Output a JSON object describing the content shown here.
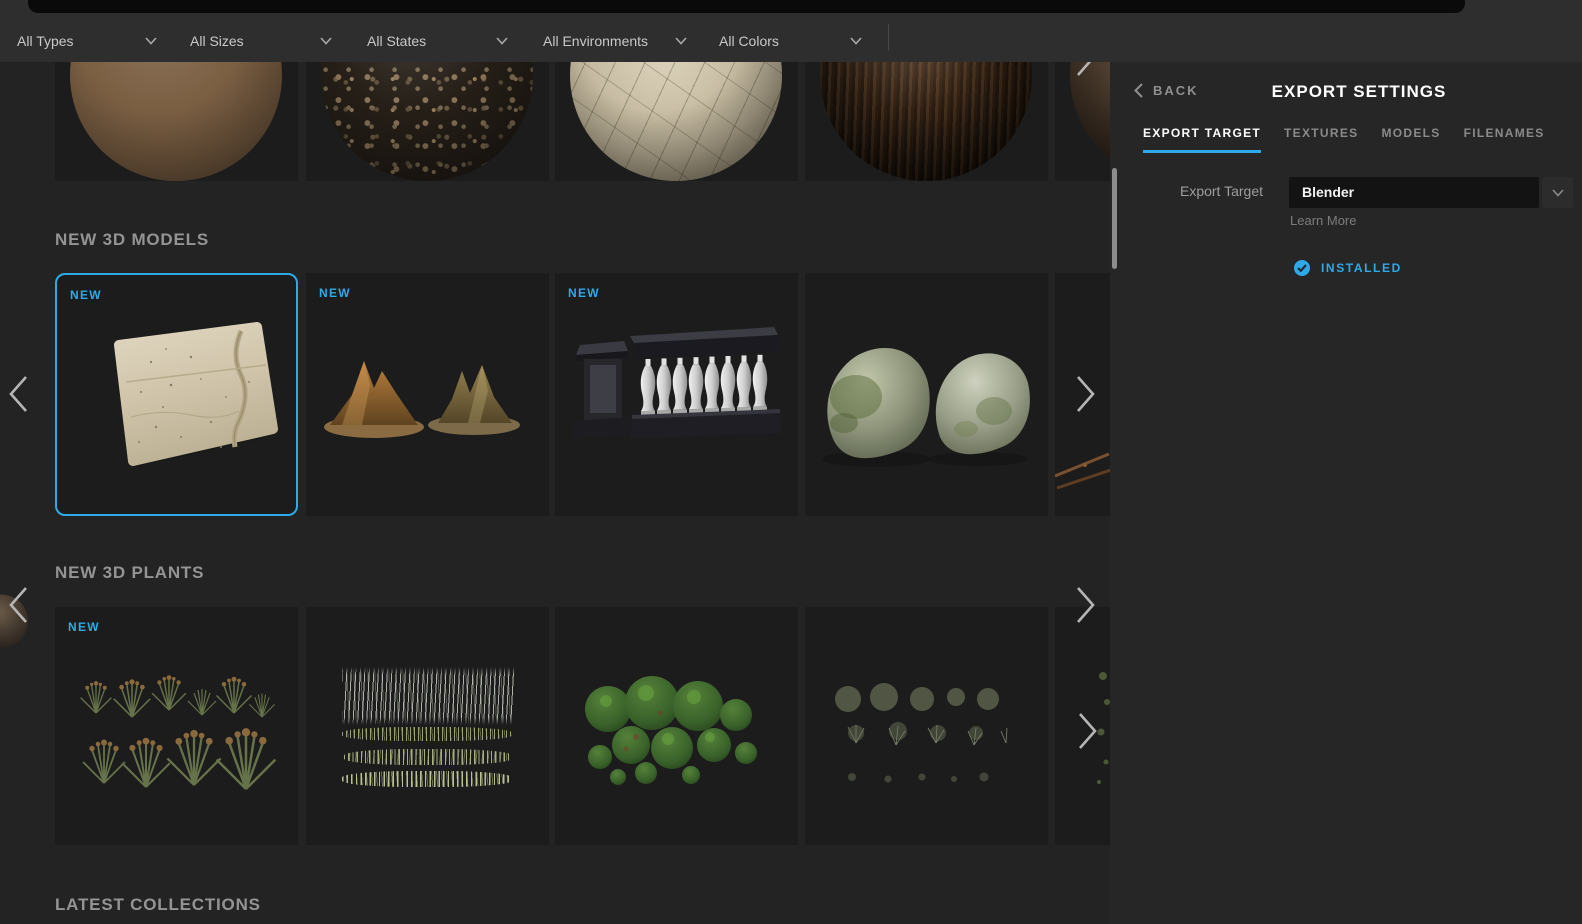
{
  "filter_bar": {
    "items": [
      {
        "label": "All Types"
      },
      {
        "label": "All Sizes"
      },
      {
        "label": "All States"
      },
      {
        "label": "All Environments"
      },
      {
        "label": "All Colors"
      }
    ]
  },
  "export_panel": {
    "back_label": "BACK",
    "title": "EXPORT SETTINGS",
    "tabs": [
      {
        "label": "EXPORT TARGET",
        "active": true
      },
      {
        "label": "TEXTURES",
        "active": false
      },
      {
        "label": "MODELS",
        "active": false
      },
      {
        "label": "FILENAMES",
        "active": false
      }
    ],
    "export_target": {
      "label": "Export Target",
      "value": "Blender",
      "learn_more_label": "Learn More",
      "status_label": "INSTALLED"
    }
  },
  "content": {
    "badge_new": "NEW",
    "sections": [
      {
        "heading": "NEW 3D MODELS"
      },
      {
        "heading": "NEW 3D PLANTS"
      },
      {
        "heading": "LATEST COLLECTIONS"
      }
    ],
    "material_thumbnails": [
      "brown-soil-sphere",
      "gravel-sphere",
      "cracked-stone-sphere",
      "tree-bark-sphere",
      "dark-sphere-partial"
    ],
    "model_thumbnails": [
      {
        "name": "desert-terrain-plane",
        "badge": "NEW",
        "selected": true
      },
      {
        "name": "sand-mounds",
        "badge": "NEW",
        "selected": false
      },
      {
        "name": "marble-balustrade",
        "badge": "NEW",
        "selected": false
      },
      {
        "name": "mossy-rocks",
        "badge": null,
        "selected": false
      },
      {
        "name": "branches-partial",
        "badge": null,
        "selected": false
      }
    ],
    "plant_thumbnails": [
      {
        "name": "dry-rush-plants",
        "badge": "NEW"
      },
      {
        "name": "tall-reed-grass",
        "badge": null
      },
      {
        "name": "green-shrubs",
        "badge": null
      },
      {
        "name": "sparse-sage-shrubs",
        "badge": null
      },
      {
        "name": "plants-partial",
        "badge": null
      }
    ]
  },
  "colors": {
    "accent_blue": "#2fa9e8",
    "selected_card_border": "#2fa9e8",
    "panel_background": "#262626",
    "content_background": "#232323",
    "filter_bar_background": "#2e2e2e"
  },
  "icons": {
    "filter_dropdown": "chevron-down-icon",
    "back": "chevron-left-icon",
    "carousel_prev": "chevron-left-icon",
    "carousel_next": "chevron-right-icon",
    "select_dropdown": "chevron-down-icon",
    "installed_status": "check-circle-icon"
  }
}
